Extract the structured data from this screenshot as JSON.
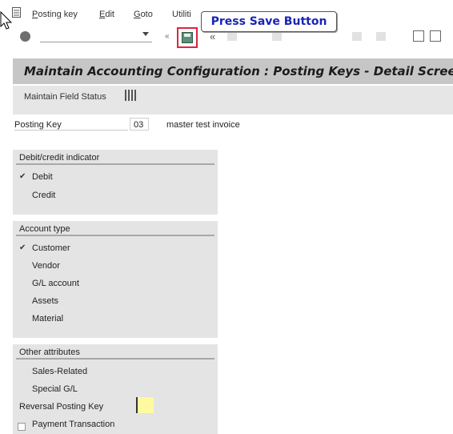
{
  "menu": {
    "items": [
      {
        "key": "posting_key",
        "first": "P",
        "rest": "osting key"
      },
      {
        "key": "edit",
        "first": "E",
        "rest": "dit"
      },
      {
        "key": "goto",
        "first": "G",
        "rest": "oto"
      },
      {
        "key": "utilities",
        "first": "",
        "rest": "Utiliti"
      }
    ]
  },
  "tooltip": {
    "text": "Press Save Button"
  },
  "toolbar": {
    "command_value": ""
  },
  "title": {
    "text": "Maintain Accounting Configuration : Posting Keys - Detail Screen"
  },
  "app_toolbar": {
    "maintain_field_status": "Maintain Field Status"
  },
  "posting_key": {
    "label": "Posting Key",
    "value": "03",
    "description": "master test invoice"
  },
  "debit_credit": {
    "title": "Debit/credit indicator",
    "options": [
      {
        "label": "Debit",
        "selected": true
      },
      {
        "label": "Credit",
        "selected": false
      }
    ]
  },
  "account_type": {
    "title": "Account type",
    "options": [
      {
        "label": "Customer",
        "selected": true
      },
      {
        "label": "Vendor",
        "selected": false
      },
      {
        "label": "G/L account",
        "selected": false
      },
      {
        "label": "Assets",
        "selected": false
      },
      {
        "label": "Material",
        "selected": false
      }
    ]
  },
  "other_attributes": {
    "title": "Other attributes",
    "items": [
      {
        "label": "Sales-Related"
      },
      {
        "label": "Special G/L"
      },
      {
        "label": "Reversal Posting Key"
      },
      {
        "label": "Payment Transaction"
      }
    ]
  },
  "colors": {
    "accent": "#e0243c",
    "tooltip_text": "#1a24b5",
    "panel": "#e4e4e4",
    "title_bar": "#c6c6c6"
  }
}
